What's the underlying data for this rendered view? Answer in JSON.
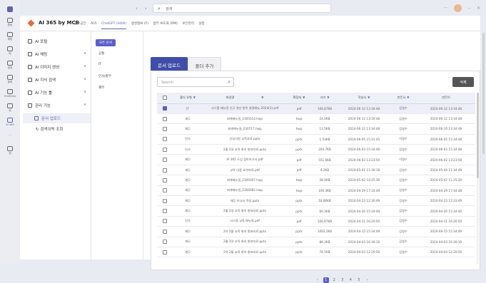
{
  "titlebar": {
    "search_text": "검색",
    "more": "···",
    "minimize": "–",
    "close": "×"
  },
  "rail": [
    {
      "label": "활동"
    },
    {
      "label": "채팅"
    },
    {
      "label": "팀"
    },
    {
      "label": "일정"
    },
    {
      "label": "통화"
    },
    {
      "label": "OneDrive"
    },
    {
      "label": "앱"
    },
    {
      "label": "AI 365"
    },
    {
      "label": "···"
    },
    {
      "label": "앱"
    }
  ],
  "app": {
    "name": "AI 365 by MCB",
    "tabs": [
      "업무공간",
      "AI거",
      "ChatGPT (AOAI)",
      "생성형AI (F)",
      "업무 AI도화 (RM)",
      "보안관리",
      "설정"
    ],
    "active_tab_index": 2
  },
  "leftmenu": {
    "items": [
      {
        "label": "AI 포털",
        "chevron": ""
      },
      {
        "label": "AI 채팅",
        "chevron": "∨"
      },
      {
        "label": "AI 이미지 생성",
        "chevron": "∨"
      },
      {
        "label": "AI 지식 검색",
        "chevron": "∨"
      },
      {
        "label": "AI 기능 툴",
        "chevron": "∨"
      },
      {
        "label": "관리 기능",
        "chevron": "∧"
      }
    ],
    "selected": "문서 업로드",
    "sub": "검색이력 조회"
  },
  "categories": {
    "all": "모든 문서",
    "items": [
      "공통",
      "IT",
      "인사/총무",
      "재무"
    ]
  },
  "content": {
    "tab_active": "문서 업로드",
    "tab_inactive": "폴더 추가",
    "search_placeholder": "Search",
    "delete_label": "삭제",
    "columns": [
      "",
      "폴더 유형",
      "파일명",
      "확장자",
      "크기",
      "작성시",
      "만든사",
      "만든이"
    ],
    "rows": [
      [
        "IT",
        "시스템 매뉴얼 신규 개선 항목 설정매뉴.2024(3).pdf",
        "pdf",
        "106.87KB",
        "2024-06-12 13:34:48",
        "김영수",
        "2024-06-12 13:34:48",
        true
      ],
      [
        "재무",
        "회계매뉴얼_2305014.hwp",
        "hwp",
        "24.0KB",
        "2024-06-12 13:34:48",
        "김영수",
        "2024-06-12 13:34:48",
        false
      ],
      [
        "재무",
        "회계매뉴얼_230717.hwp",
        "hwp",
        "13.5KB",
        "2024-06-12 13:34:48",
        "김영수",
        "2024-06-10 13:34:48",
        false
      ],
      [
        "인사",
        "신입사원 교육자료.pptx",
        "pptx",
        "1.53KB",
        "2024-06-05 15:31:45",
        "이명수",
        "2024-06-05 15:34:48",
        false
      ],
      [
        "인사",
        "2월 2일 교육 회의 발표자료.pptx",
        "pptx",
        "204.7KB",
        "2024-06-03 15:34:48",
        "김영수",
        "2024-06-03 15:34:48",
        false
      ],
      [
        "재무",
        "AI 365 도입 검토보고서.pdf",
        "pdf",
        "551.6KB",
        "2024-06-03 13:23:50",
        "이명수",
        "2024-06-02 13:23:50",
        false
      ],
      [
        "재무",
        "교육 내용 요약자료.pdf",
        "pdf",
        "4.2KB",
        "2024-05-01 11:30:18",
        "김영수",
        "2024-05-04 11:34:48",
        false
      ],
      [
        "재무",
        "회계매뉴얼_2305007.hwp",
        "hwp",
        "28.0KB",
        "2024-05-02 14:25:30",
        "김영수",
        "2024-05-02 11:25:30",
        false
      ],
      [
        "재무",
        "회계매뉴얼_2304082.hwp",
        "hwp",
        "100.3KB",
        "2024-04-29 17:34:49",
        "김영수",
        "2024-04-29 17:34:48",
        false
      ],
      [
        "재무",
        "재무 보고서 작성.pptx",
        "pptx",
        "18.86KB",
        "2024-04-23 12:30:49",
        "김영수",
        "2024-04-23 12:33:49",
        false
      ],
      [
        "재무",
        "2월 2일 교육 회의 발표자료.pptx",
        "pptx",
        "69.3KB",
        "2024-04-20 15:34:49",
        "김영수",
        "2024-04-20 15:34:40",
        false
      ],
      [
        "인사",
        "시스템 교육 매뉴얼.pdf",
        "pdf",
        "106.87KB",
        "2024-04-11 16:20:50",
        "김영수",
        "2024-04-11 16:26:50",
        false
      ],
      [
        "재무",
        "2차 2월 교육 회의 발표자료.pptx",
        "pptx",
        "1063.2KB",
        "2024-04-15 15:34:49",
        "김영수",
        "2024-04-15 15:34:49",
        false
      ],
      [
        "재무",
        "2월 2일 교육 회의 발표자료.pptx",
        "pptx",
        "89.3KB",
        "2024-04-03 16:30:10",
        "김영수",
        "2024-04-03 16:30:10",
        false
      ],
      [
        "재무",
        "2차 2월 교육 회의 발표자료.pptx",
        "pptx",
        "78.5KB",
        "2024-04-03 12:20:50",
        "김영수",
        "2024-04-03 12:20:50",
        false
      ]
    ]
  },
  "pager": {
    "prev": "‹",
    "pages": [
      "1",
      "2",
      "3",
      "4",
      "5"
    ],
    "current": "1",
    "next": "›"
  }
}
